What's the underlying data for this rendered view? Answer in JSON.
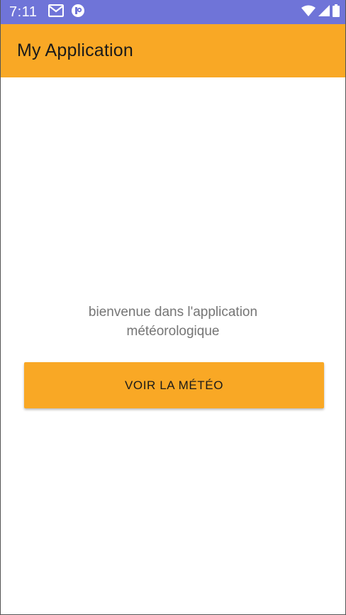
{
  "status_bar": {
    "time": "7:11",
    "background": "#6f74d8",
    "left_icons": [
      "gmail-icon",
      "app-notification-icon"
    ],
    "right_icons": [
      "wifi-icon",
      "cell-signal-icon",
      "battery-icon"
    ]
  },
  "app_bar": {
    "title": "My Application",
    "background": "#f9a825"
  },
  "main": {
    "welcome_line_1": "bienvenue dans l'application",
    "welcome_line_2": "météorologique",
    "button_label": "VOIR LA MÉTÉO",
    "accent": "#f9a825"
  }
}
